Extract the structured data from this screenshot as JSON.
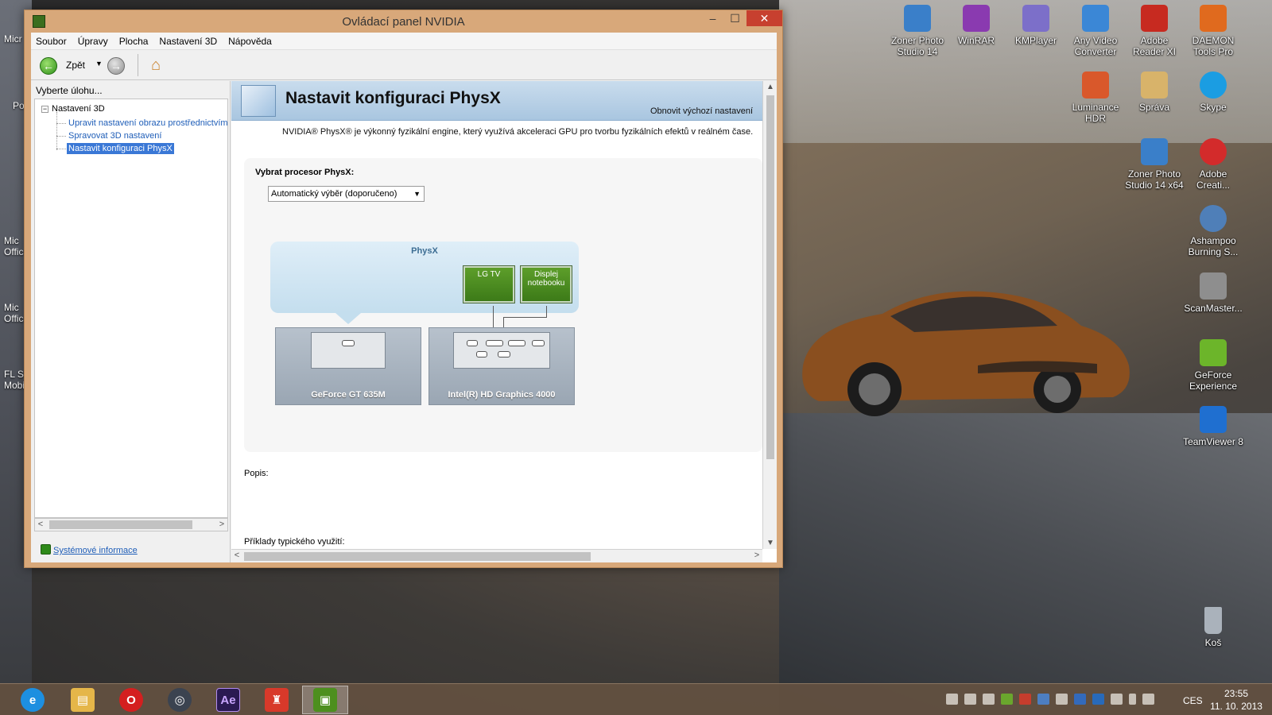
{
  "window": {
    "title": "Ovládací panel NVIDIA",
    "controls": {
      "minimize": "–",
      "maximize": "☐",
      "close": "✕"
    }
  },
  "menu": [
    "Soubor",
    "Úpravy",
    "Plocha",
    "Nastavení 3D",
    "Nápověda"
  ],
  "toolbar": {
    "back_label": "Zpět"
  },
  "left_pane": {
    "task_label": "Vyberte úlohu...",
    "tree_root": "Nastavení 3D",
    "tree_items": [
      "Upravit nastavení obrazu prostřednictvím n",
      "Spravovat 3D nastavení",
      "Nastavit konfiguraci PhysX"
    ],
    "selected_index": 2,
    "system_info_link": "Systémové informace"
  },
  "content": {
    "title": "Nastavit konfiguraci PhysX",
    "restore_defaults": "Obnovit výchozí nastavení",
    "intro": "NVIDIA® PhysX® je výkonný fyzikální engine, který využívá akceleraci GPU pro tvorbu fyzikálních efektů v reálném čase.",
    "processor_label": "Vybrat procesor PhysX:",
    "processor_selected": "Automatický výběr (doporučeno)",
    "diagram": {
      "physx_label": "PhysX",
      "displays": [
        "LG TV",
        "Displej notebooku"
      ],
      "gpus": [
        "GeForce GT 635M",
        "Intel(R) HD Graphics 4000"
      ]
    },
    "description_label": "Popis:",
    "examples_label": "Příklady typického využití:"
  },
  "desktop_icons": [
    {
      "label": "Zoner Photo Studio 14",
      "color": "#3a7fc9"
    },
    {
      "label": "WinRAR",
      "color": "#8a3ab0"
    },
    {
      "label": "KMPlayer",
      "color": "#7c6fc9"
    },
    {
      "label": "Any Video Converter",
      "color": "#3b87d6"
    },
    {
      "label": "Adobe Reader XI",
      "color": "#c72a20"
    },
    {
      "label": "DAEMON Tools Pro",
      "color": "#e06a1e"
    },
    {
      "label": "Luminance HDR",
      "color": "#d9582b"
    },
    {
      "label": "Správa",
      "color": "#d8b36a"
    },
    {
      "label": "Skype",
      "color": "#1b9de2"
    },
    {
      "label": "Zoner Photo Studio 14 x64",
      "color": "#3a7fc9"
    },
    {
      "label": "Adobe Creati...",
      "color": "#d32b2b"
    },
    {
      "label": "Ashampoo Burning S...",
      "color": "#4f7fb8"
    },
    {
      "label": "ScanMaster...",
      "color": "#8e8e8e"
    },
    {
      "label": "GeForce Experience",
      "color": "#6cb52a"
    },
    {
      "label": "TeamViewer 8",
      "color": "#1f6fd0"
    },
    {
      "label": "Koš",
      "color": "#aab2bb"
    }
  ],
  "edge_labels": [
    "Micr",
    "Po",
    "Mic Offic",
    "Mic Offic",
    "FL S Mobi"
  ],
  "taskbar": {
    "apps": [
      {
        "name": "internet-explorer",
        "glyph": "e",
        "color": "#1d8fe0"
      },
      {
        "name": "file-explorer",
        "glyph": "▤",
        "color": "#e5b649"
      },
      {
        "name": "opera",
        "glyph": "O",
        "color": "#d41f1f"
      },
      {
        "name": "steam",
        "glyph": "◎",
        "color": "#3b4350"
      },
      {
        "name": "after-effects",
        "glyph": "Ae",
        "color": "#2a1a52"
      },
      {
        "name": "game-app",
        "glyph": "♜",
        "color": "#d8392a"
      },
      {
        "name": "nvidia-control-panel",
        "glyph": "▣",
        "color": "#4d8f1e"
      }
    ],
    "active_app": "nvidia-control-panel",
    "language": "CES",
    "time": "23:55",
    "date": "11. 10. 2013"
  }
}
